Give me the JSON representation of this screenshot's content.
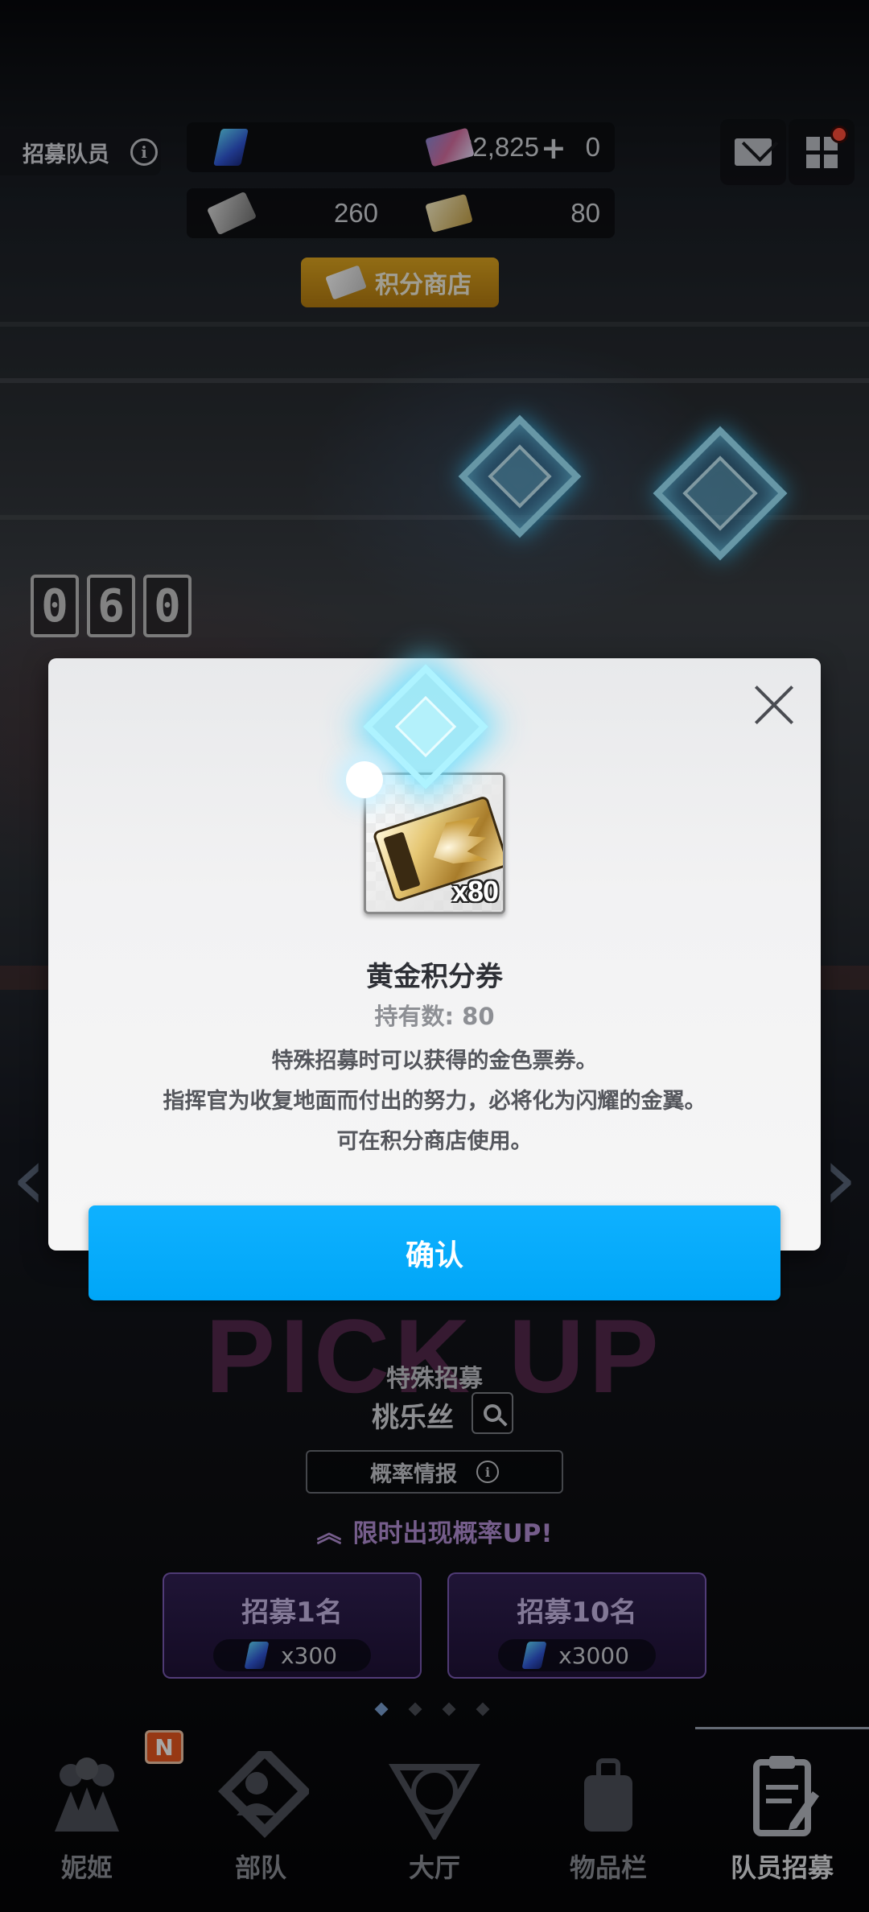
{
  "header": {
    "title": "招募队员",
    "resources": {
      "blue_gem": "32,825",
      "ticket": "0",
      "silver_points": "260",
      "gold_points": "80"
    },
    "shop_button": "积分商店"
  },
  "background": {
    "counter_digits": [
      "0",
      "6",
      "0"
    ]
  },
  "banner": {
    "pickup_text": "PICK UP",
    "type_label": "特殊招募",
    "character_name": "桃乐丝",
    "probability_button": "概率情报",
    "limited_text": "限时出现概率UP!",
    "draw_one": {
      "label": "招募1名",
      "cost": "x300"
    },
    "draw_ten": {
      "label": "招募10名",
      "cost": "x3000"
    }
  },
  "nav": {
    "items": [
      {
        "label": "妮姬",
        "badge": "N"
      },
      {
        "label": "部队"
      },
      {
        "label": "大厅"
      },
      {
        "label": "物品栏"
      },
      {
        "label": "队员招募"
      }
    ],
    "active_index": 4
  },
  "modal": {
    "item_quantity": "x80",
    "item_name": "黄金积分券",
    "held_count": "持有数: 80",
    "description_lines": [
      "特殊招募时可以获得的金色票券。",
      "指挥官为收复地面而付出的努力，必将化为闪耀的金翼。",
      "可在积分商店使用。"
    ],
    "confirm_label": "确认"
  },
  "colors": {
    "confirm_button": "#00a6f7",
    "shop_button": "#d49a18",
    "limited_text": "#b48fd6",
    "badge": "#e8561f"
  }
}
